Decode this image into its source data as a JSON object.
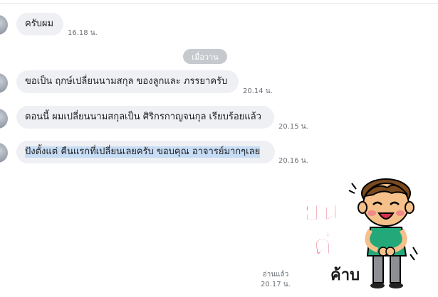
{
  "messages": [
    {
      "text": "ครับผม",
      "time": "16.18 น."
    },
    {
      "text": "ขอเป็น ฤกษ์เปลี่ยนนามสกุล ของลูกและ ภรรยาครับ",
      "time": "20.14 น."
    },
    {
      "text": "ตอนนี้ ผมเปลี่ยนนามสกุลเป็น ศิริกรกาญจนกุล เรียบร้อยแล้ว",
      "time": "20.15 น."
    },
    {
      "text": "ปังตั้งแต่ คืนแรกที่เปลี่ยนเลยครับ ขอบคุณ อาจารย์มากๆเลย",
      "time": "20.16 น."
    }
  ],
  "date_separator": "เมื่อวาน",
  "sticker": {
    "icon": "yin-dee-kha-sticker-icon",
    "text_line1": "ยิน",
    "text_line2": "ดี",
    "text_line3": "ค้าบ"
  },
  "read_status": {
    "label": "อ่านแล้ว",
    "time": "20.17 น."
  },
  "colors": {
    "bubble": "#eef0f3",
    "highlight": "#c7dcf5",
    "pill": "#c6c9ce"
  }
}
